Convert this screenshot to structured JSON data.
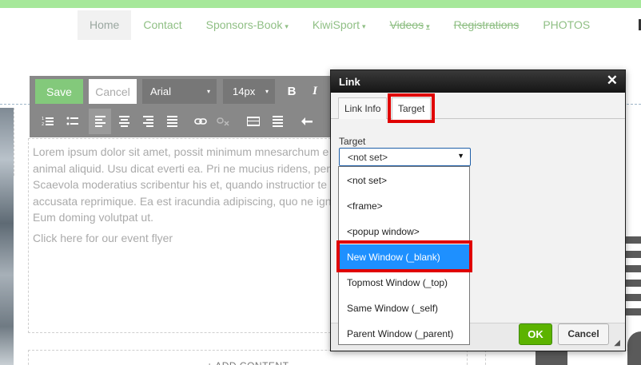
{
  "nav": {
    "items": [
      {
        "label": "Home"
      },
      {
        "label": "Contact"
      },
      {
        "label": "Sponsors-Book",
        "caret": "▾"
      },
      {
        "label": "KiwiSport",
        "caret": "▾"
      },
      {
        "label": "Videos",
        "caret": "▾"
      },
      {
        "label": "Registrations"
      },
      {
        "label": "PHOTOS"
      }
    ]
  },
  "toolbar": {
    "save_label": "Save",
    "cancel_label": "Cancel",
    "font_value": "Arial",
    "size_value": "14px",
    "bold_label": "B",
    "italic_label": "I",
    "dropdown_arrow": "▾"
  },
  "editor": {
    "lines": [
      "Lorem ipsum dolor sit amet, possit minimum mnesarchum e",
      "animal aliquid. Usu dicat everti ea. Pri ne mucius ridens, per",
      "Scaevola moderatius scribentur his et, quando instructior te",
      "accusata reprimique. Ea est iracundia adipiscing, quo ne ign",
      "Eum doming volutpat ut."
    ],
    "flyer": "Click here for our event flyer"
  },
  "page": {
    "add_content": "+ ADD CONTENT"
  },
  "dialog": {
    "title": "Link",
    "close_glyph": "✕",
    "tabs": {
      "link_info": "Link Info",
      "target": "Target"
    },
    "target_label": "Target",
    "target_value": "<not set>",
    "select_arrow": "▼",
    "ok_label": "OK",
    "cancel_label": "Cancel",
    "resize_glyph": "◢"
  },
  "dropdown": {
    "options": [
      "<not set>",
      "<frame>",
      "<popup window>",
      "New Window (_blank)",
      "Topmost Window (_top)",
      "Same Window (_self)",
      "Parent Window (_parent)"
    ]
  },
  "colors": {
    "top_band": "#a6e89a",
    "nav_text": "#8fbf84",
    "save_button": "#83c97b",
    "ok_button": "#5cb300",
    "selected_option": "#1e90ff",
    "highlight_box": "#e00000"
  },
  "icons": [
    "numbered-list-icon",
    "bullet-list-icon",
    "align-left-icon",
    "align-center-icon",
    "align-right-icon",
    "justify-icon",
    "link-icon",
    "unlink-icon",
    "table-icon",
    "horizontal-rule-icon",
    "undo-icon"
  ]
}
